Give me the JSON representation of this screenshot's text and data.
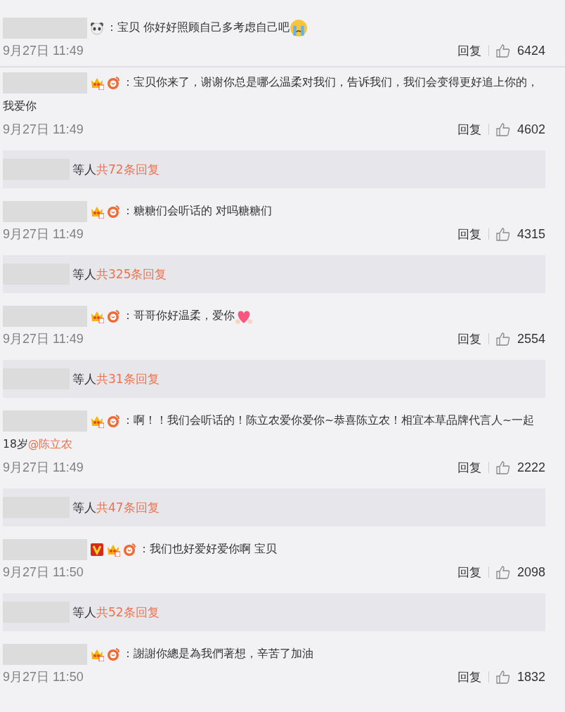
{
  "comments": [
    {
      "badges": [
        {
          "kind": "panda"
        }
      ],
      "text": [
        {
          "kind": "text",
          "t": "：宝贝 你好好照顾自己多考虑自己吧"
        }
      ],
      "emoji": {
        "kind": "crying"
      },
      "time": "9月27日 11:49",
      "reply": "回复",
      "likes": "6424"
    },
    {
      "badges": [
        {
          "kind": "crown"
        },
        {
          "kind": "weibo"
        }
      ],
      "text": [
        {
          "kind": "text",
          "t": "：宝贝你来了，谢谢你总是哪么温柔对我们，告诉我们，我们会变得更好追上你的，我爱你"
        }
      ],
      "time": "9月27日 11:49",
      "reply": "回复",
      "likes": "4602",
      "summary": {
        "label": "等人",
        "count": "共72条回复"
      }
    },
    {
      "badges": [
        {
          "kind": "crown"
        },
        {
          "kind": "weibo"
        }
      ],
      "text": [
        {
          "kind": "text",
          "t": "：糖糖们会听话的 对吗糖糖们"
        }
      ],
      "time": "9月27日 11:49",
      "reply": "回复",
      "likes": "4315",
      "summary": {
        "label": "等人",
        "count": "共325条回复"
      }
    },
    {
      "badges": [
        {
          "kind": "crown"
        },
        {
          "kind": "weibo"
        }
      ],
      "text": [
        {
          "kind": "text",
          "t": "：哥哥你好温柔，爱你"
        }
      ],
      "emoji": {
        "kind": "heart"
      },
      "time": "9月27日 11:49",
      "reply": "回复",
      "likes": "2554",
      "summary": {
        "label": "等人",
        "count": "共31条回复"
      }
    },
    {
      "badges": [
        {
          "kind": "crown"
        },
        {
          "kind": "weibo"
        }
      ],
      "text": [
        {
          "kind": "text",
          "t": "：啊！！我们会听话的！陈立农爱你爱你~恭喜陈立农！相宜本草品牌代言人~一起18岁"
        },
        {
          "kind": "mention",
          "t": "@陈立农"
        }
      ],
      "time": "9月27日 11:49",
      "reply": "回复",
      "likes": "2222",
      "summary": {
        "label": "等人",
        "count": "共47条回复"
      }
    },
    {
      "badges": [
        {
          "kind": "vip"
        },
        {
          "kind": "crown"
        },
        {
          "kind": "weibo"
        }
      ],
      "text": [
        {
          "kind": "text",
          "t": "：我们也好爱好爱你啊 宝贝"
        }
      ],
      "time": "9月27日 11:50",
      "reply": "回复",
      "likes": "2098",
      "summary": {
        "label": "等人",
        "count": "共52条回复"
      }
    },
    {
      "badges": [
        {
          "kind": "crown"
        },
        {
          "kind": "weibo"
        }
      ],
      "text": [
        {
          "kind": "text",
          "t": "：謝謝你總是為我們著想，辛苦了加油"
        }
      ],
      "time": "9月27日 11:50",
      "reply": "回复",
      "likes": "1832"
    }
  ]
}
